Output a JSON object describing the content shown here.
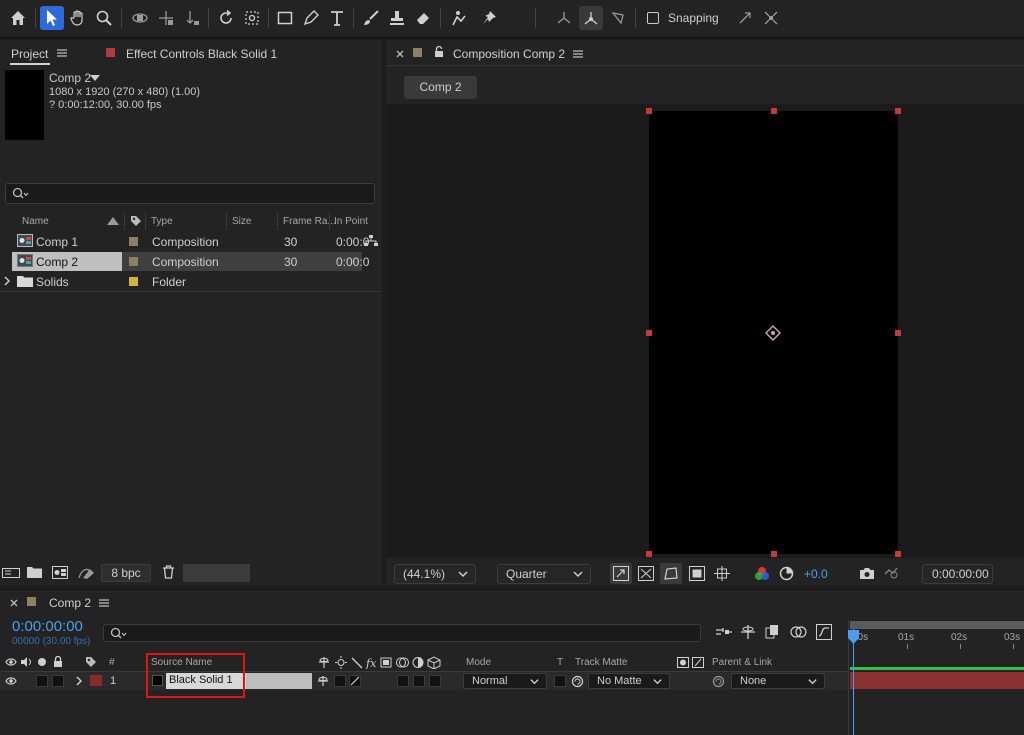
{
  "toolbar": {
    "snapping_label": "Snapping"
  },
  "project_panel": {
    "tab_label": "Project",
    "effect_controls_tab": "Effect Controls Black Solid 1",
    "selected_item": {
      "name": "Comp 2",
      "dimensions": "1080 x 1920  (270 x 480) (1.00)",
      "duration": "? 0:00:12:00, 30.00 fps"
    },
    "columns": [
      "Name",
      "Type",
      "Size",
      "Frame Ra...",
      "In Point"
    ],
    "items": [
      {
        "name": "Comp 1",
        "type": "Composition",
        "frame_rate": "30",
        "in_point": "0:00:0",
        "label_color": "#8f7e66"
      },
      {
        "name": "Comp 2",
        "type": "Composition",
        "frame_rate": "30",
        "in_point": "0:00:0",
        "label_color": "#8f7e66"
      },
      {
        "name": "Solids",
        "type": "Folder",
        "label_color": "#d2b43a"
      }
    ],
    "bpc_label": "8 bpc"
  },
  "composition_panel": {
    "tab_label": "Composition Comp 2",
    "comp_tab": "Comp 2",
    "zoom": "(44.1%)",
    "resolution": "Quarter",
    "exposure": "+0.0",
    "timecode": "0:00:00:00"
  },
  "timeline": {
    "tab_label": "Comp 2",
    "timecode": "0:00:00:00",
    "fps_label": "00000 (30.00 fps)",
    "columns": {
      "number": "#",
      "source_name": "Source Name",
      "mode": "Mode",
      "track_t": "T",
      "track_matte": "Track Matte",
      "parent_link": "Parent & Link"
    },
    "layer": {
      "number": "1",
      "source_name": "Black Solid 1",
      "mode": "Normal",
      "track_matte": "No Matte",
      "parent": "None",
      "label_color": "#8a2a2a"
    },
    "ruler_ticks": [
      "00s",
      "01s",
      "02s",
      "03s"
    ]
  }
}
